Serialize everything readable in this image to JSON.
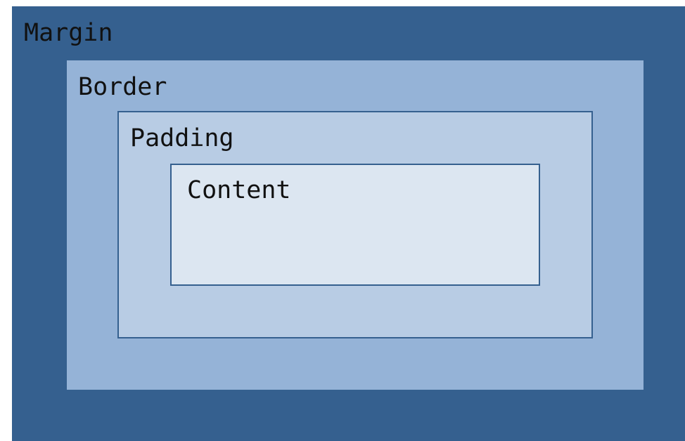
{
  "diagram": {
    "layers": {
      "margin": {
        "label": "Margin",
        "color": "#35608f"
      },
      "border": {
        "label": "Border",
        "color": "#95b3d7"
      },
      "padding": {
        "label": "Padding",
        "color": "#b8cce4"
      },
      "content": {
        "label": "Content",
        "color": "#dce6f1"
      }
    }
  }
}
